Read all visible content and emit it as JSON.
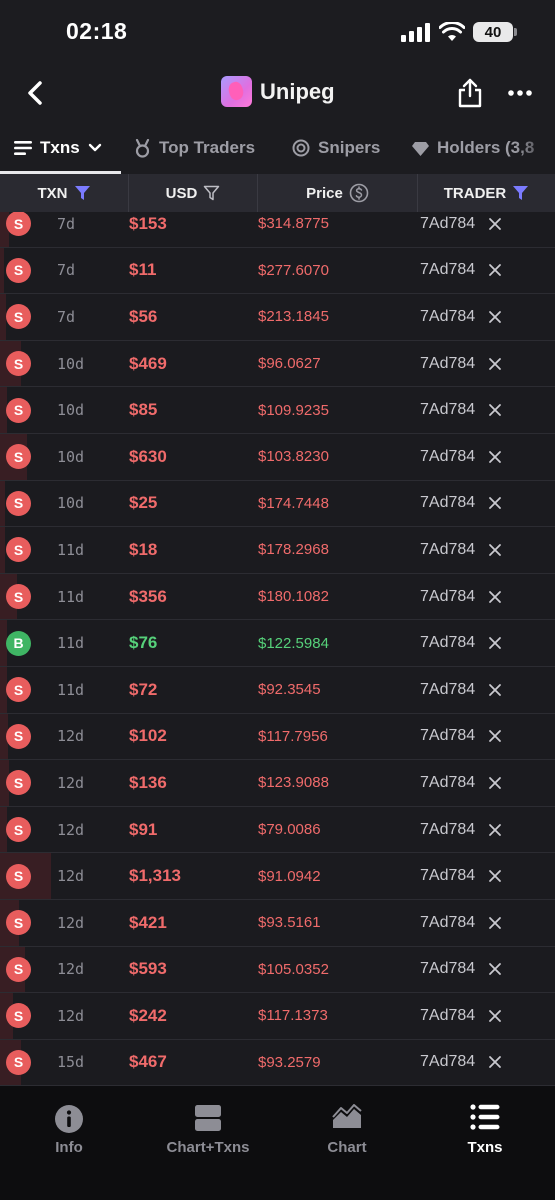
{
  "status_bar": {
    "time": "02:18",
    "battery": "40"
  },
  "nav": {
    "title": "Unipeg"
  },
  "tabs": [
    {
      "label": "Txns",
      "active": true,
      "icon": "list-icon"
    },
    {
      "label": "Top Traders",
      "active": false,
      "icon": "medal-icon"
    },
    {
      "label": "Snipers",
      "active": false,
      "icon": "target-icon"
    },
    {
      "label": "Holders (3,8",
      "active": false,
      "icon": "diamond-icon"
    }
  ],
  "table_headers": {
    "txn": "TXN",
    "usd": "USD",
    "price": "Price",
    "trader": "TRADER"
  },
  "rows": [
    {
      "type": "S",
      "age": "7d",
      "usd": "$153",
      "price": "$314.8775",
      "trader": "7Ad784"
    },
    {
      "type": "S",
      "age": "7d",
      "usd": "$11",
      "price": "$277.6070",
      "trader": "7Ad784"
    },
    {
      "type": "S",
      "age": "7d",
      "usd": "$56",
      "price": "$213.1845",
      "trader": "7Ad784"
    },
    {
      "type": "S",
      "age": "10d",
      "usd": "$469",
      "price": "$96.0627",
      "trader": "7Ad784"
    },
    {
      "type": "S",
      "age": "10d",
      "usd": "$85",
      "price": "$109.9235",
      "trader": "7Ad784"
    },
    {
      "type": "S",
      "age": "10d",
      "usd": "$630",
      "price": "$103.8230",
      "trader": "7Ad784"
    },
    {
      "type": "S",
      "age": "10d",
      "usd": "$25",
      "price": "$174.7448",
      "trader": "7Ad784"
    },
    {
      "type": "S",
      "age": "11d",
      "usd": "$18",
      "price": "$178.2968",
      "trader": "7Ad784"
    },
    {
      "type": "S",
      "age": "11d",
      "usd": "$356",
      "price": "$180.1082",
      "trader": "7Ad784"
    },
    {
      "type": "B",
      "age": "11d",
      "usd": "$76",
      "price": "$122.5984",
      "trader": "7Ad784"
    },
    {
      "type": "S",
      "age": "11d",
      "usd": "$72",
      "price": "$92.3545",
      "trader": "7Ad784"
    },
    {
      "type": "S",
      "age": "12d",
      "usd": "$102",
      "price": "$117.7956",
      "trader": "7Ad784"
    },
    {
      "type": "S",
      "age": "12d",
      "usd": "$136",
      "price": "$123.9088",
      "trader": "7Ad784"
    },
    {
      "type": "S",
      "age": "12d",
      "usd": "$91",
      "price": "$79.0086",
      "trader": "7Ad784"
    },
    {
      "type": "S",
      "age": "12d",
      "usd": "$1,313",
      "price": "$91.0942",
      "trader": "7Ad784"
    },
    {
      "type": "S",
      "age": "12d",
      "usd": "$421",
      "price": "$93.5161",
      "trader": "7Ad784"
    },
    {
      "type": "S",
      "age": "12d",
      "usd": "$593",
      "price": "$105.0352",
      "trader": "7Ad784"
    },
    {
      "type": "S",
      "age": "12d",
      "usd": "$242",
      "price": "$117.1373",
      "trader": "7Ad784"
    },
    {
      "type": "S",
      "age": "15d",
      "usd": "$467",
      "price": "$93.2579",
      "trader": "7Ad784"
    }
  ],
  "bottom_tabs": [
    {
      "label": "Info",
      "icon": "info-icon",
      "active": false
    },
    {
      "label": "Chart+Txns",
      "icon": "split-view-icon",
      "active": false
    },
    {
      "label": "Chart",
      "icon": "area-chart-icon",
      "active": false
    },
    {
      "label": "Txns",
      "icon": "list-icon",
      "active": true
    }
  ],
  "colors": {
    "background": "#1c1c20",
    "sell": "#f06b6b",
    "buy": "#56d17a",
    "filter_active": "#7b7bff"
  }
}
